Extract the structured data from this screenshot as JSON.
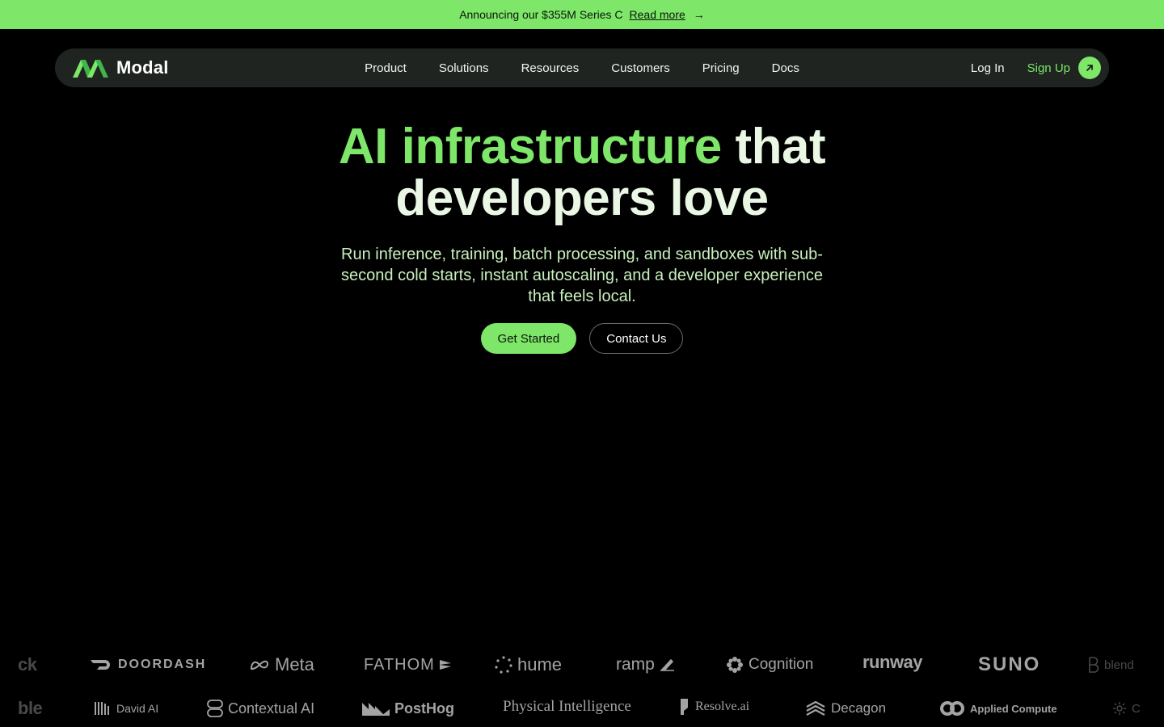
{
  "banner": {
    "text": "Announcing our $355M Series C",
    "link": "Read more",
    "arrow": "→"
  },
  "nav": {
    "brand": "Modal",
    "links": [
      "Product",
      "Solutions",
      "Resources",
      "Customers",
      "Pricing",
      "Docs"
    ],
    "login": "Log In",
    "signup": "Sign Up"
  },
  "hero": {
    "headline_green": "AI infrastructure",
    "headline_rest1": " that",
    "headline_line2": "developers love",
    "subtitle": "Run inference, training, batch processing, and sandboxes with sub-second cold starts, instant autoscaling, and a developer experience that feels local.",
    "primary_cta": "Get Started",
    "secondary_cta": "Contact Us"
  },
  "logos": {
    "row1": [
      "ck",
      "DOORDASH",
      "Meta",
      "FATHOM",
      "hume",
      "ramp",
      "Cognition",
      "runway",
      "SUNO",
      "blend"
    ],
    "row2": [
      "ble",
      "David AI",
      "Contextual AI",
      "PostHog",
      "Physical Intelligence",
      "Resolve.ai",
      "Decagon",
      "Applied Compute",
      "C"
    ]
  },
  "colors": {
    "accent": "#7ee668",
    "background": "#000000",
    "nav_bg": "#1f2420",
    "subtitle": "#c9f0bd",
    "logo_gray": "#a3a3a3"
  }
}
